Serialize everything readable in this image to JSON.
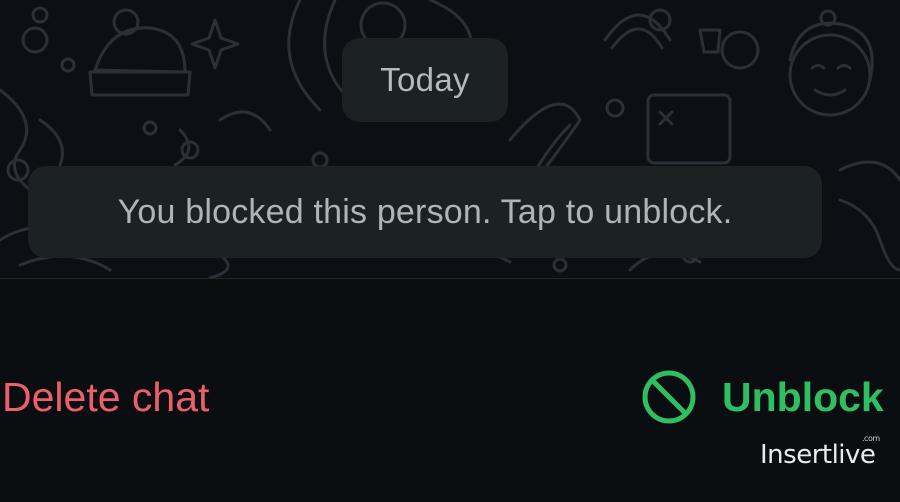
{
  "chat": {
    "date_label": "Today",
    "system_message": "You blocked this person. Tap to unblock."
  },
  "actions": {
    "delete_label": "Delete chat",
    "unblock_label": "Unblock",
    "unblock_icon": "block-icon"
  },
  "watermark": {
    "text": "Insertlive",
    "suffix": ".com"
  },
  "colors": {
    "background": "#0b0e11",
    "bubble": "#1c2124",
    "delete": "#ec5f6c",
    "unblock": "#2fbf62"
  }
}
